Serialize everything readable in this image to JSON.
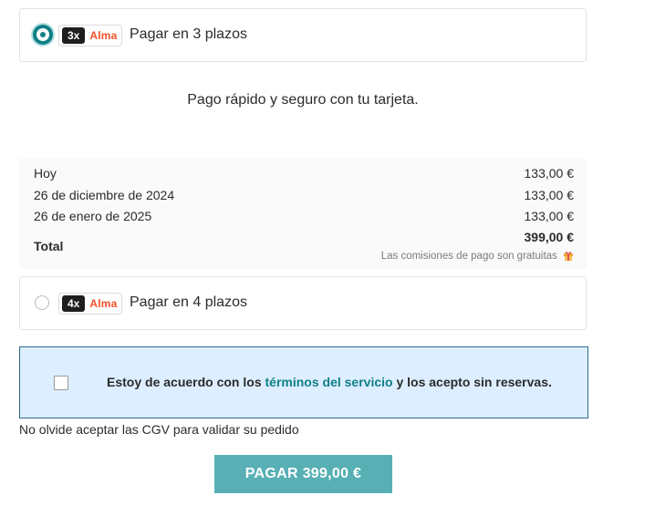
{
  "options": [
    {
      "badge_count": "3x",
      "badge_brand": "Alma",
      "label": "Pagar en 3 plazos",
      "selected": true
    },
    {
      "badge_count": "4x",
      "badge_brand": "Alma",
      "label": "Pagar en 4 plazos",
      "selected": false
    }
  ],
  "tagline": "Pago rápido y seguro con tu tarjeta.",
  "schedule": {
    "rows": [
      {
        "date": "Hoy",
        "amount": "133,00 €"
      },
      {
        "date": "26 de diciembre de 2024",
        "amount": "133,00 €"
      },
      {
        "date": "26 de enero de 2025",
        "amount": "133,00 €"
      }
    ],
    "total_label": "Total",
    "total_amount": "399,00 €",
    "fees_note": "Las comisiones de pago son gratuitas",
    "fees_icon": "gift-icon"
  },
  "terms": {
    "prefix": "Estoy de acuerdo con los",
    "link": "términos del servicio",
    "suffix": "y los acepto sin reservas.",
    "checked": false
  },
  "cgv_note": "No olvide aceptar las CGV para validar su pedido",
  "pay_button": "PAGAR 399,00 €",
  "colors": {
    "accent": "#0f7f86",
    "button": "#58b0b5",
    "alma": "#f2512a",
    "terms_bg": "#dceeff"
  }
}
